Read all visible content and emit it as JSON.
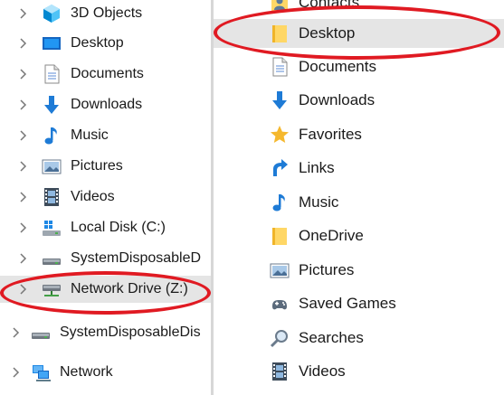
{
  "navigation_pane": {
    "items": [
      {
        "label": "3D Objects",
        "icon": "3d-objects-icon",
        "expandable": true
      },
      {
        "label": "Desktop",
        "icon": "desktop-icon",
        "expandable": true
      },
      {
        "label": "Documents",
        "icon": "documents-icon",
        "expandable": true
      },
      {
        "label": "Downloads",
        "icon": "downloads-icon",
        "expandable": true
      },
      {
        "label": "Music",
        "icon": "music-icon",
        "expandable": true
      },
      {
        "label": "Pictures",
        "icon": "pictures-icon",
        "expandable": true
      },
      {
        "label": "Videos",
        "icon": "videos-icon",
        "expandable": true
      },
      {
        "label": "Local Disk (C:)",
        "icon": "local-disk-icon",
        "expandable": true
      },
      {
        "label": "SystemDisposableD",
        "icon": "drive-icon",
        "expandable": true
      },
      {
        "label": "Network Drive (Z:)",
        "icon": "network-drive-icon",
        "expandable": true,
        "selected": true,
        "highlighted": true
      },
      {
        "label": "SystemDisposableDis",
        "icon": "drive-icon",
        "expandable": true
      },
      {
        "label": "Network",
        "icon": "network-icon",
        "expandable": true
      }
    ]
  },
  "content_pane": {
    "items": [
      {
        "label": "Contacts",
        "icon": "contacts-icon"
      },
      {
        "label": "Desktop",
        "icon": "folder-icon",
        "hovered": true,
        "highlighted": true
      },
      {
        "label": "Documents",
        "icon": "documents-icon"
      },
      {
        "label": "Downloads",
        "icon": "downloads-icon"
      },
      {
        "label": "Favorites",
        "icon": "favorites-icon"
      },
      {
        "label": "Links",
        "icon": "links-icon"
      },
      {
        "label": "Music",
        "icon": "music-icon"
      },
      {
        "label": "OneDrive",
        "icon": "folder-icon"
      },
      {
        "label": "Pictures",
        "icon": "pictures-icon"
      },
      {
        "label": "Saved Games",
        "icon": "saved-games-icon"
      },
      {
        "label": "Searches",
        "icon": "searches-icon"
      },
      {
        "label": "Videos",
        "icon": "videos-icon"
      }
    ]
  },
  "colors": {
    "selection": "#cce8ff",
    "hover": "#e5e5e5",
    "annotation": "#e01a22",
    "folder": "#ffd766",
    "blue_accent": "#1e7bd6"
  }
}
